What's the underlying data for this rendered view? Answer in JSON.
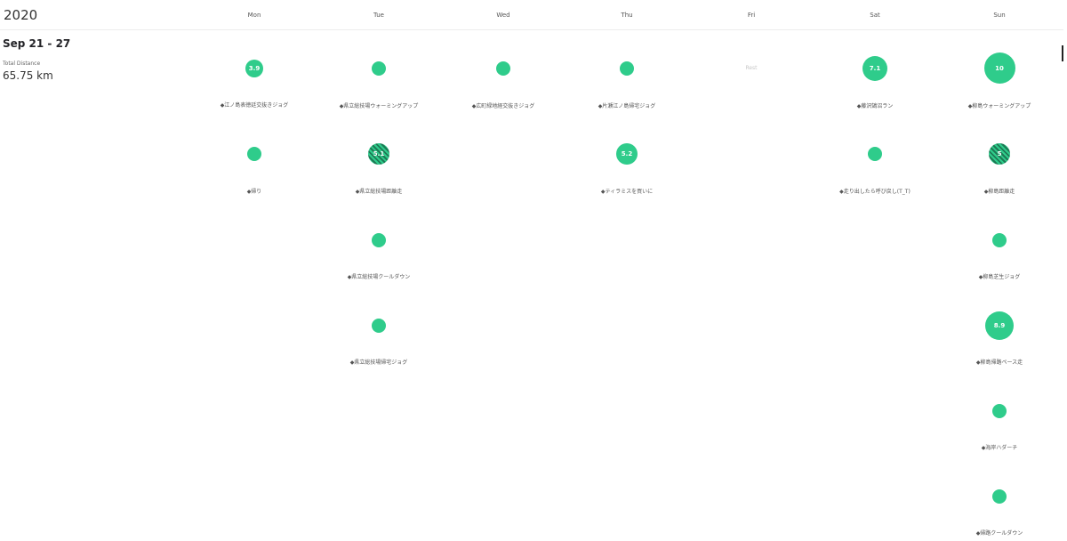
{
  "header": {
    "year": "2020"
  },
  "days": [
    "Mon",
    "Tue",
    "Wed",
    "Thu",
    "Fri",
    "Sat",
    "Sun"
  ],
  "summary": {
    "week_range": "Sep 21 - 27",
    "distance_label": "Total Distance",
    "distance_value": "65.75 km"
  },
  "fri_rest": "Rest",
  "activities": {
    "mon": [
      {
        "value": "3.9",
        "label": "◆江ノ島表徳廷交抜きジョグ",
        "style": "solid"
      },
      {
        "value": "",
        "label": "◆帰り",
        "style": "solid"
      }
    ],
    "tue": [
      {
        "value": "",
        "label": "◆県立総技場ウォーミングアップ",
        "style": "solid"
      },
      {
        "value": "5.1",
        "label": "◆県立総技場距離走",
        "style": "striped"
      },
      {
        "value": "",
        "label": "◆県立総技場クールダウン",
        "style": "solid"
      },
      {
        "value": "",
        "label": "◆県立総技場帰宅ジョグ",
        "style": "solid"
      }
    ],
    "wed": [
      {
        "value": "",
        "label": "◆広町緑地経交抜きジョグ",
        "style": "solid"
      }
    ],
    "thu": [
      {
        "value": "",
        "label": "◆片瀬江ノ島帰宅ジョグ",
        "style": "solid"
      },
      {
        "value": "5.2",
        "label": "◆ティラミスを買いに",
        "style": "solid"
      }
    ],
    "sat": [
      {
        "value": "7.1",
        "label": "◆藤沢鵠沼ラン",
        "style": "solid"
      },
      {
        "value": "",
        "label": "◆走り出したら呼び戻し(T_T)",
        "style": "solid"
      }
    ],
    "sun": [
      {
        "value": "10",
        "label": "◆柳島ウォーミングアップ",
        "style": "solid"
      },
      {
        "value": "5",
        "label": "◆柳島距離走",
        "style": "striped"
      },
      {
        "value": "",
        "label": "◆柳島芝生ジョグ",
        "style": "solid"
      },
      {
        "value": "8.9",
        "label": "◆柳島帰路ペース走",
        "style": "solid"
      },
      {
        "value": "",
        "label": "◆海岸ハダーチ",
        "style": "solid"
      },
      {
        "value": "",
        "label": "◆帰路クールダウン",
        "style": "solid"
      }
    ]
  }
}
